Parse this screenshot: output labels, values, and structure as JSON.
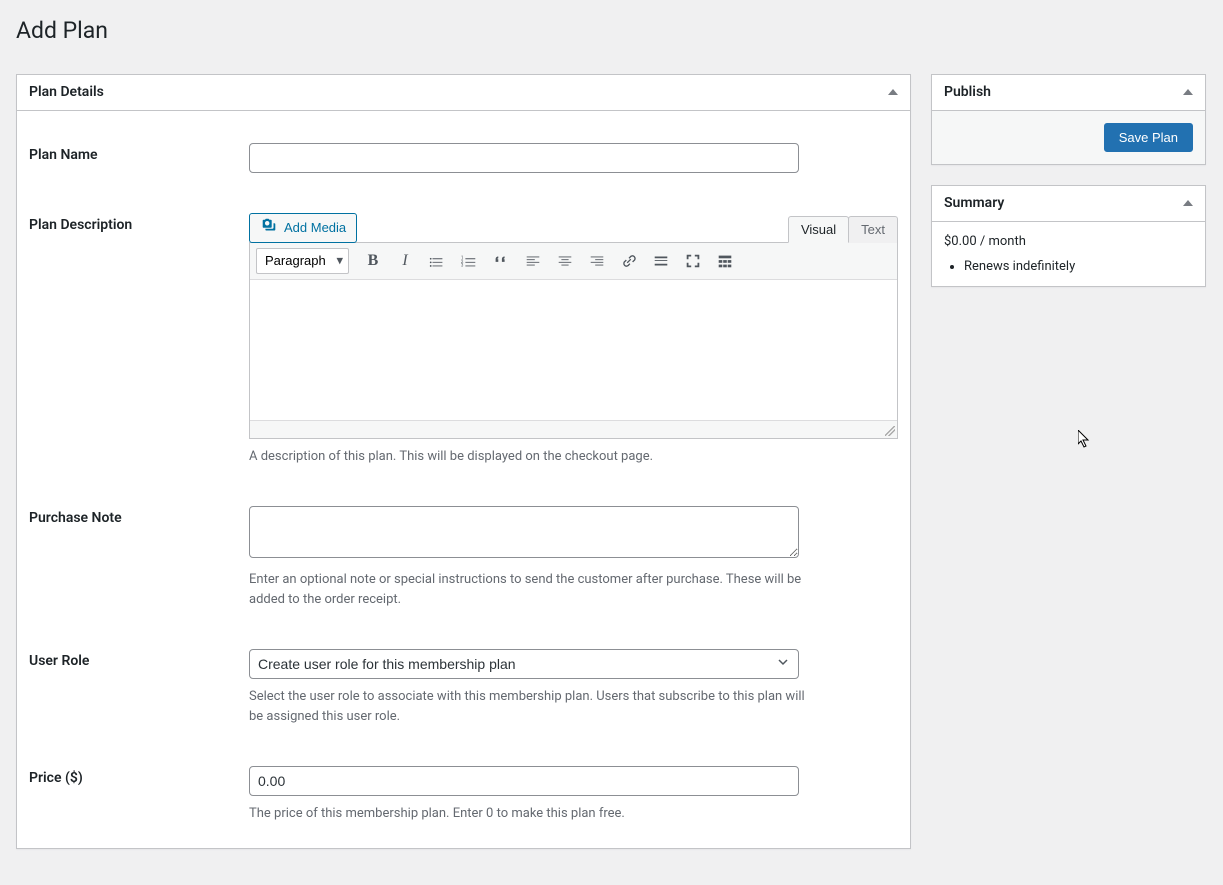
{
  "page_title": "Add Plan",
  "plan_details": {
    "panel_title": "Plan Details",
    "name_label": "Plan Name",
    "name_value": "",
    "description_label": "Plan Description",
    "add_media_label": "Add Media",
    "tabs": {
      "visual": "Visual",
      "text": "Text"
    },
    "format_select": "Paragraph",
    "description_help": "A description of this plan. This will be displayed on the checkout page.",
    "purchase_note_label": "Purchase Note",
    "purchase_note_value": "",
    "purchase_note_help": "Enter an optional note or special instructions to send the customer after purchase. These will be added to the order receipt.",
    "user_role_label": "User Role",
    "user_role_value": "Create user role for this membership plan",
    "user_role_help": "Select the user role to associate with this membership plan. Users that subscribe to this plan will be assigned this user role.",
    "price_label": "Price ($)",
    "price_value": "0.00",
    "price_help": "The price of this membership plan. Enter 0 to make this plan free."
  },
  "publish": {
    "panel_title": "Publish",
    "save_label": "Save Plan"
  },
  "summary": {
    "panel_title": "Summary",
    "price_text": "$0.00 / month",
    "renew_text": "Renews indefinitely"
  }
}
